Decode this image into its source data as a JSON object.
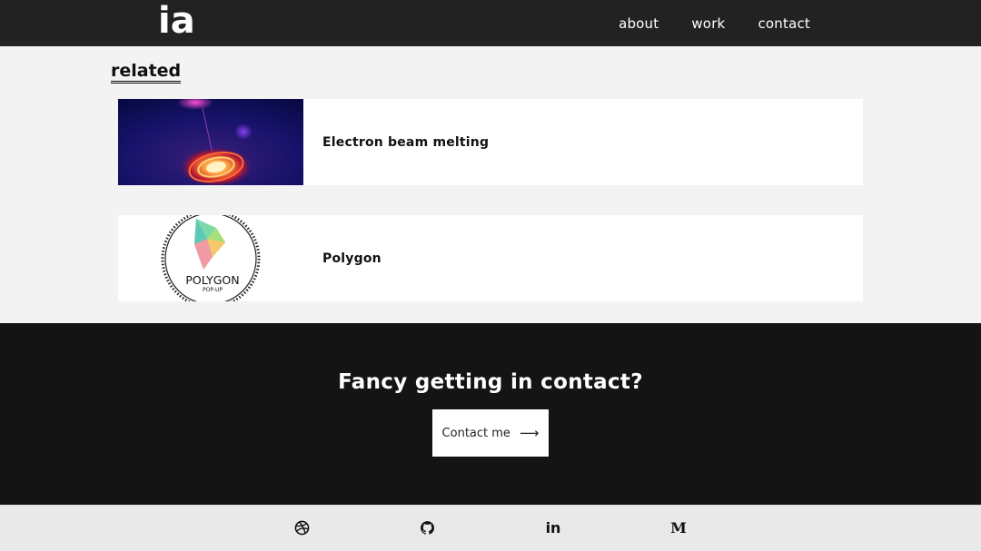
{
  "header": {
    "logo": "ia",
    "nav": [
      {
        "label": "about"
      },
      {
        "label": "work"
      },
      {
        "label": "contact"
      }
    ]
  },
  "related": {
    "heading": "related",
    "items": [
      {
        "title": "Electron beam melting",
        "thumb_icon": "electron-beam-image"
      },
      {
        "title": "Polygon",
        "thumb_icon": "polygon-logo-image",
        "thumb_text": "POLYGON",
        "thumb_subtext": "POP-UP"
      }
    ]
  },
  "contact": {
    "heading": "Fancy getting in contact?",
    "button_label": "Contact me",
    "button_arrow": "⟶"
  },
  "footer": {
    "social": [
      {
        "icon": "dribbble-icon"
      },
      {
        "icon": "github-icon"
      },
      {
        "icon": "linkedin-icon",
        "glyph": "in"
      },
      {
        "icon": "medium-icon",
        "glyph": "M"
      }
    ]
  },
  "colors": {
    "header_bg": "#222222",
    "page_bg": "#f3f3f3",
    "contact_bg": "#141414",
    "footer_bg": "#e9e9e9"
  }
}
